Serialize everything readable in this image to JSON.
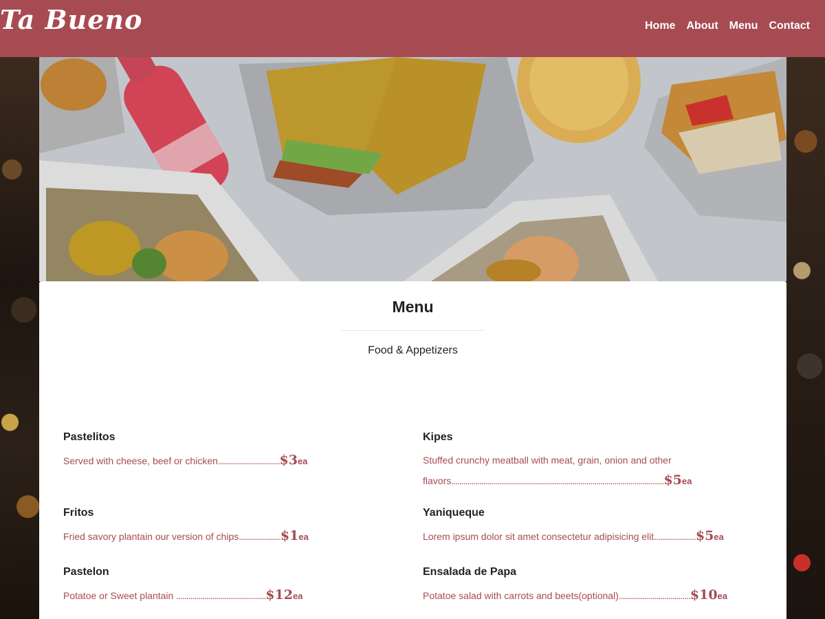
{
  "brand": {
    "logo_text": "Ta Bueno"
  },
  "nav": {
    "items": [
      "Home",
      "About",
      "Menu",
      "Contact"
    ]
  },
  "menu": {
    "title": "Menu",
    "subtitle": "Food & Appetizers",
    "items": [
      {
        "name": "Pastelitos",
        "desc": "Served with cheese, beef or chicken",
        "dots": "...............................",
        "price": "$3",
        "unit": "ea"
      },
      {
        "name": "Kipes",
        "desc": "Stuffed crunchy meatball with meat, grain, onion and other flavors",
        "dots": "...........................................................................................................",
        "price": "$5",
        "unit": "ea"
      },
      {
        "name": "Fritos",
        "desc": "Fried savory plantain our version of chips",
        "dots": ".....................",
        "price": "$1",
        "unit": "ea"
      },
      {
        "name": "Yaniqueque",
        "desc": "Lorem ipsum dolor sit amet consectetur adipisicing elit",
        "dots": ".....................",
        "price": "$5",
        "unit": "ea"
      },
      {
        "name": "Pastelon",
        "desc": "Potatoe or Sweet plantain ",
        "dots": ".............................................",
        "price": "$12",
        "unit": "ea"
      },
      {
        "name": "Ensalada de Papa",
        "desc": "Potatoe salad with carrots and beets(optional)",
        "dots": "....................................",
        "price": "$10",
        "unit": "ea"
      }
    ]
  },
  "colors": {
    "brand": "#a64b52",
    "text": "#222222",
    "panel": "#ffffff"
  }
}
